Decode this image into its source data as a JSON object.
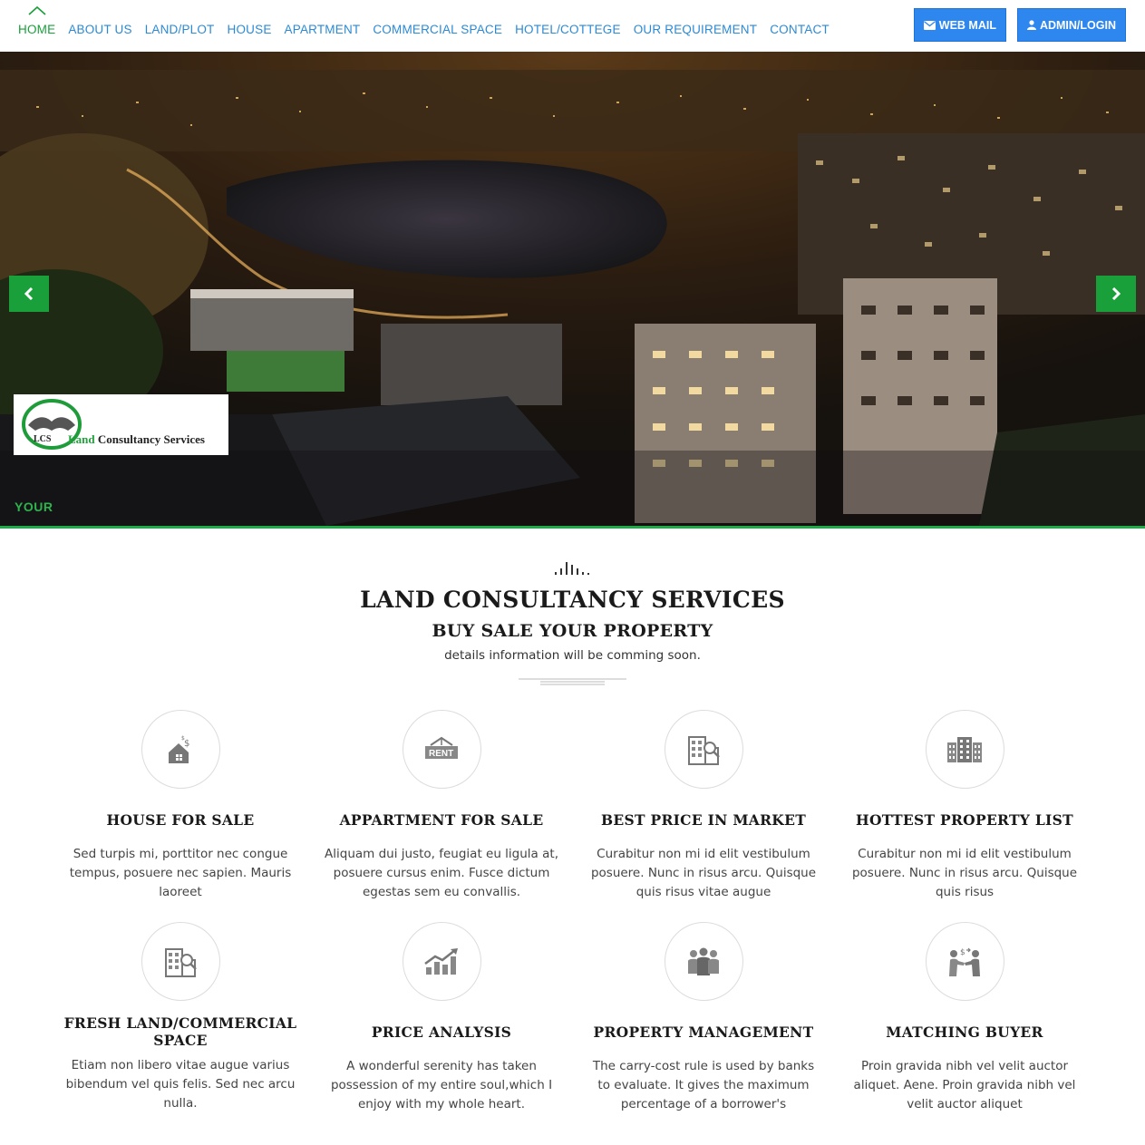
{
  "nav": {
    "items": [
      {
        "label": "HOME",
        "active": true
      },
      {
        "label": "ABOUT US"
      },
      {
        "label": "LAND/PLOT"
      },
      {
        "label": "HOUSE"
      },
      {
        "label": "APARTMENT"
      },
      {
        "label": "COMMERCIAL SPACE"
      },
      {
        "label": "HOTEL/COTTEGE"
      },
      {
        "label": "OUR REQUIREMENT"
      },
      {
        "label": "CONTACT"
      }
    ],
    "webmail_label": "WEB MAIL",
    "admin_label": "ADMIN/LOGIN"
  },
  "hero": {
    "logo": {
      "initials": "LCS",
      "land": "Land",
      "rest": "Consultancy Services"
    },
    "caption": "YOUR"
  },
  "section": {
    "title": "LAND CONSULTANCY SERVICES",
    "subtitle": "BUY SALE YOUR PROPERTY",
    "description": "details information will be comming soon."
  },
  "services": [
    {
      "icon": "house-dollar-icon",
      "title": "HOUSE FOR SALE",
      "text": "Sed turpis mi, porttitor nec congue tempus, posuere nec sapien. Mauris laoreet"
    },
    {
      "icon": "rent-sign-icon",
      "title": "APPARTMENT FOR SALE",
      "text": "Aliquam dui justo, feugiat eu ligula at, posuere cursus enim. Fusce dictum egestas sem eu convallis."
    },
    {
      "icon": "building-search-icon",
      "title": "BEST PRICE IN MARKET",
      "text": "Curabitur non mi id elit vestibulum posuere. Nunc in risus arcu. Quisque quis risus vitae augue"
    },
    {
      "icon": "buildings-icon",
      "title": "HOTTEST PROPERTY LIST",
      "text": "Curabitur non mi id elit vestibulum posuere. Nunc in risus arcu. Quisque quis risus"
    },
    {
      "icon": "building-search-icon",
      "title": "FRESH LAND/COMMERCIAL SPACE",
      "text": "Etiam non libero vitae augue varius bibendum vel quis felis. Sed nec arcu nulla."
    },
    {
      "icon": "chart-growth-icon",
      "title": "PRICE ANALYSIS",
      "text": "A wonderful serenity has taken possession of my entire soul,which I enjoy with my whole heart."
    },
    {
      "icon": "people-group-icon",
      "title": "PROPERTY MANAGEMENT",
      "text": "The carry-cost rule is used by banks to evaluate. It gives the maximum percentage of a borrower's"
    },
    {
      "icon": "handshake-deal-icon",
      "title": "MATCHING BUYER",
      "text": "Proin gravida nibh vel velit auctor aliquet. Aene. Proin gravida nibh vel velit auctor aliquet"
    }
  ],
  "colors": {
    "accent_green": "#19a03a",
    "link_blue": "#2b8ad6",
    "button_blue": "#2e87ef"
  }
}
